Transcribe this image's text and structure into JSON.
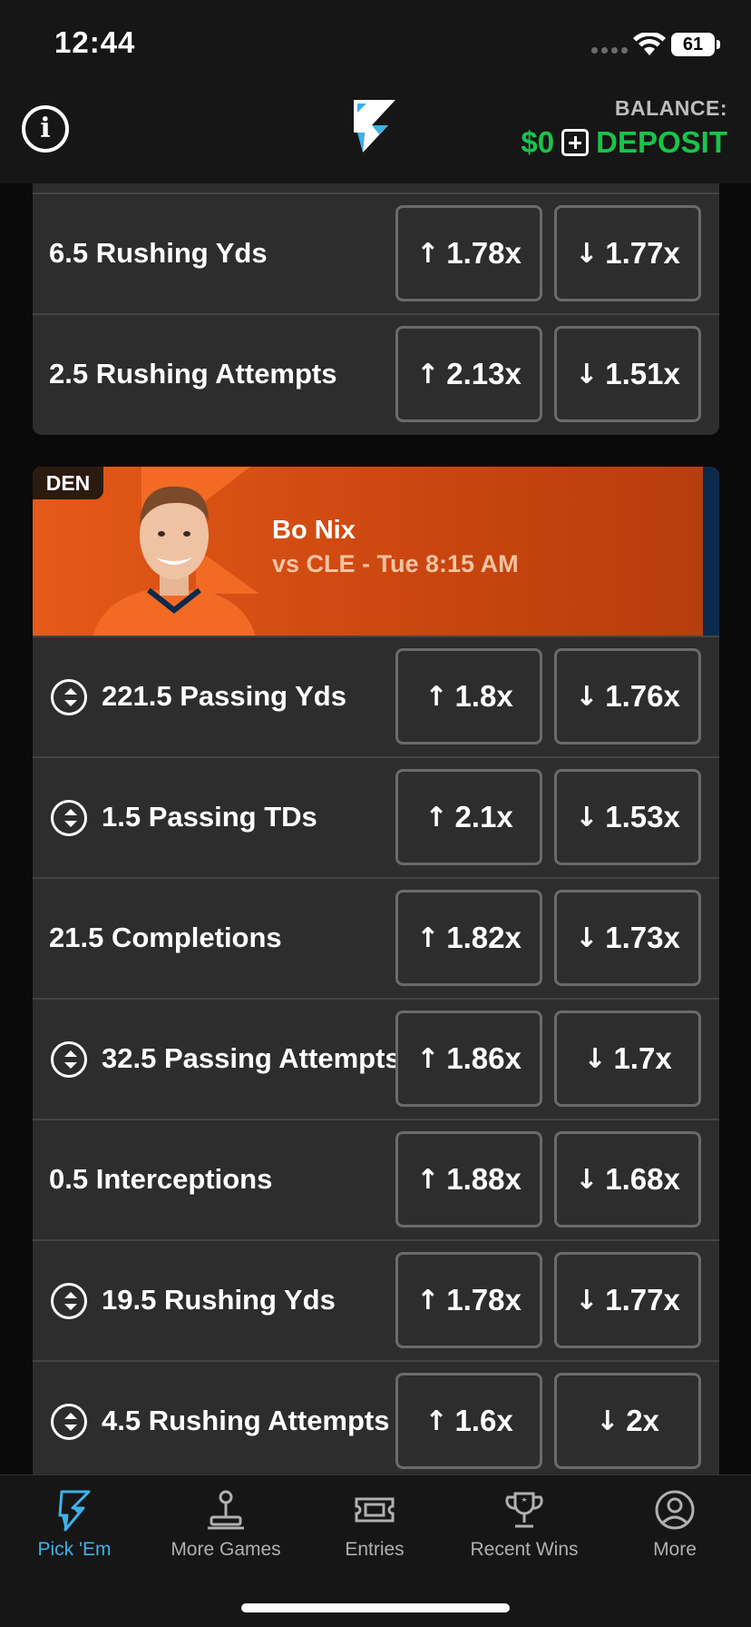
{
  "status_bar": {
    "time": "12:44",
    "battery": "61"
  },
  "header": {
    "balance_label": "BALANCE:",
    "balance_amount": "$0",
    "deposit_label": "DEPOSIT",
    "colors": {
      "balance": "#19c44b",
      "background": "#161616"
    }
  },
  "card_top": {
    "rows": [
      {
        "label": "6.5 Rushing Yds",
        "over": "1.78x",
        "under": "1.77x"
      },
      {
        "label": "2.5 Rushing Attempts",
        "over": "2.13x",
        "under": "1.51x"
      }
    ]
  },
  "player": {
    "team": "DEN",
    "name": "Bo Nix",
    "game": "vs CLE - Tue 8:15 AM",
    "colors": {
      "banner": "#e45a18",
      "stripe": "#0c2a4b"
    }
  },
  "card_player": {
    "rows": [
      {
        "label": "221.5 Passing Yds",
        "over": "1.8x",
        "under": "1.76x",
        "icon": "sort-icon"
      },
      {
        "label": "1.5 Passing TDs",
        "over": "2.1x",
        "under": "1.53x",
        "icon": "sort-icon"
      },
      {
        "label": "21.5 Completions",
        "over": "1.82x",
        "under": "1.73x",
        "icon": ""
      },
      {
        "label": "32.5 Passing Attempts",
        "over": "1.86x",
        "under": "1.7x",
        "icon": "sort-icon"
      },
      {
        "label": "0.5 Interceptions",
        "over": "1.88x",
        "under": "1.68x",
        "icon": ""
      },
      {
        "label": "19.5 Rushing Yds",
        "over": "1.78x",
        "under": "1.77x",
        "icon": "sort-icon"
      },
      {
        "label": "4.5 Rushing Attempts",
        "over": "1.6x",
        "under": "2x",
        "icon": "sort-icon"
      }
    ]
  },
  "arrows": {
    "up": "↑",
    "down": "↓"
  },
  "nav": {
    "items": [
      {
        "label": "Pick 'Em",
        "icon": "bolt-icon"
      },
      {
        "label": "More Games",
        "icon": "joystick-icon"
      },
      {
        "label": "Entries",
        "icon": "ticket-icon"
      },
      {
        "label": "Recent Wins",
        "icon": "trophy-icon"
      },
      {
        "label": "More",
        "icon": "user-circle-icon"
      }
    ],
    "active_color": "#3eb1e8"
  }
}
